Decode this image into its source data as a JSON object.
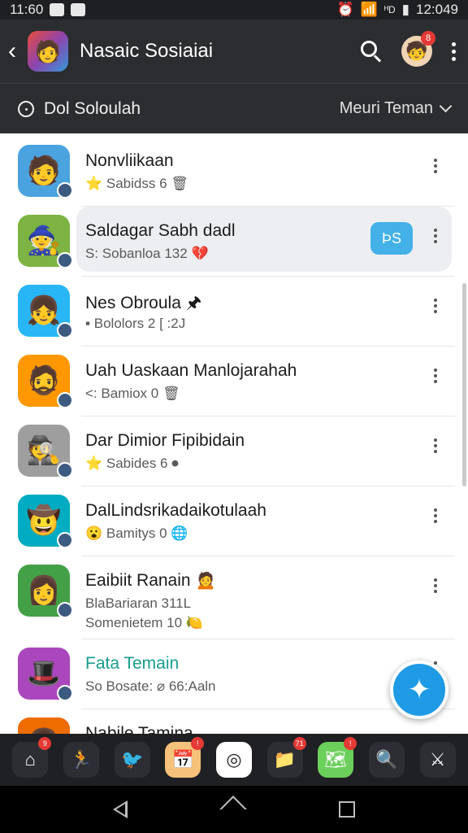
{
  "status_bar": {
    "time_left": "11:60",
    "time_right": "12:049",
    "signal_text": "ᴴD"
  },
  "app_bar": {
    "title": "Nasaic Sosiaiai",
    "back_icon": "back-arrow-icon",
    "profile_badge": "8"
  },
  "sub_bar": {
    "left_label": "Dol Soloulah",
    "right_label": "Meuri Teman"
  },
  "contacts": [
    {
      "name": "Nonvliikaan",
      "meta": "⭐ Sabidss 6 🗑",
      "avatar_color": "#4aa3df",
      "avatar_glyph": "🧑"
    },
    {
      "name": "Saldagar Sabh dadl",
      "meta": "S: Sobanloa 132 💔",
      "avatar_color": "#7cb342",
      "avatar_glyph": "🧙",
      "highlighted": true,
      "tag": "ÞS"
    },
    {
      "name": "Nes Obroula 🖈",
      "meta": "▪ Bololors 2 [ :2J",
      "avatar_color": "#29b6f6",
      "avatar_glyph": "👧"
    },
    {
      "name": "Uah Uaskaan Manlojarahah",
      "meta": "<: Bamiox 0 🗑",
      "avatar_color": "#ff9800",
      "avatar_glyph": "🧔"
    },
    {
      "name": "Dar Dimior Fipibidain",
      "meta": "⭐ Sabides 6 ⏺",
      "avatar_color": "#9e9e9e",
      "avatar_glyph": "🕵"
    },
    {
      "name": "DalLindsrikadaikotulaah",
      "meta": "😮 Bamitys 0 🌐",
      "avatar_color": "#00acc1",
      "avatar_glyph": "🤠"
    },
    {
      "name": "Eaibiit Ranain 🙍",
      "meta": "BlaBariaran 311L",
      "meta2": "Somenietem 10 🍋",
      "avatar_color": "#43a047",
      "avatar_glyph": "👩"
    },
    {
      "name": "Fata Temain",
      "meta": "So Bosate: ⌀ 66:Aaln",
      "avatar_color": "#ab47bc",
      "avatar_glyph": "🎩",
      "teal": true
    },
    {
      "name": "Nabile Tamina",
      "meta": "",
      "avatar_color": "#ef6c00",
      "avatar_glyph": "👦"
    }
  ],
  "fab": {
    "icon": "sparkle-icon",
    "glyph": "✦"
  },
  "dock": [
    {
      "name": "home-app",
      "glyph": "⌂",
      "color": "#2d2e33",
      "badge": "9"
    },
    {
      "name": "runner-app",
      "glyph": "🏃",
      "color": "#2d2e33"
    },
    {
      "name": "bird-app",
      "glyph": "🐦",
      "color": "#2d2e33"
    },
    {
      "name": "calendar-app",
      "glyph": "📅",
      "color": "#f4c27b",
      "badge": "!"
    },
    {
      "name": "camera-app",
      "glyph": "◎",
      "color": "#ffffff"
    },
    {
      "name": "folder-app",
      "glyph": "📁",
      "color": "#2d2e33",
      "badge": "71"
    },
    {
      "name": "maps-app",
      "glyph": "🗺",
      "color": "#6ccf5b",
      "badge": "!"
    },
    {
      "name": "search-app",
      "glyph": "🔍",
      "color": "#2d2e33"
    },
    {
      "name": "game-app",
      "glyph": "⚔",
      "color": "#2d2e33"
    }
  ]
}
